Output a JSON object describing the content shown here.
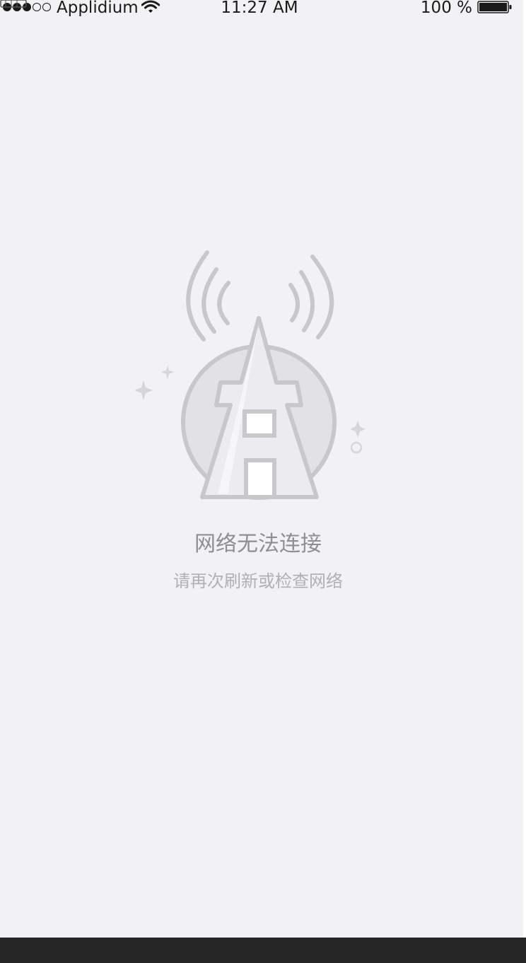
{
  "status_bar": {
    "carrier": "Applidium",
    "time": "11:27 AM",
    "battery_percent": "100 %",
    "signal_filled": 3,
    "signal_total": 5,
    "icons": [
      "signal-dots-icon",
      "wifi-icon",
      "battery-icon"
    ]
  },
  "empty_state": {
    "title": "网络无法连接",
    "subtitle": "请再次刷新或检查网络",
    "illustration": "broadcast-tower-offline-icon"
  },
  "colors": {
    "background": "#f2f2f4",
    "title_text": "#8e8e93",
    "subtitle_text": "#b0b0b5",
    "illustration_stroke": "#c8c8cc",
    "illustration_fill": "#e4e4e7",
    "bottom_bar": "#262626"
  }
}
